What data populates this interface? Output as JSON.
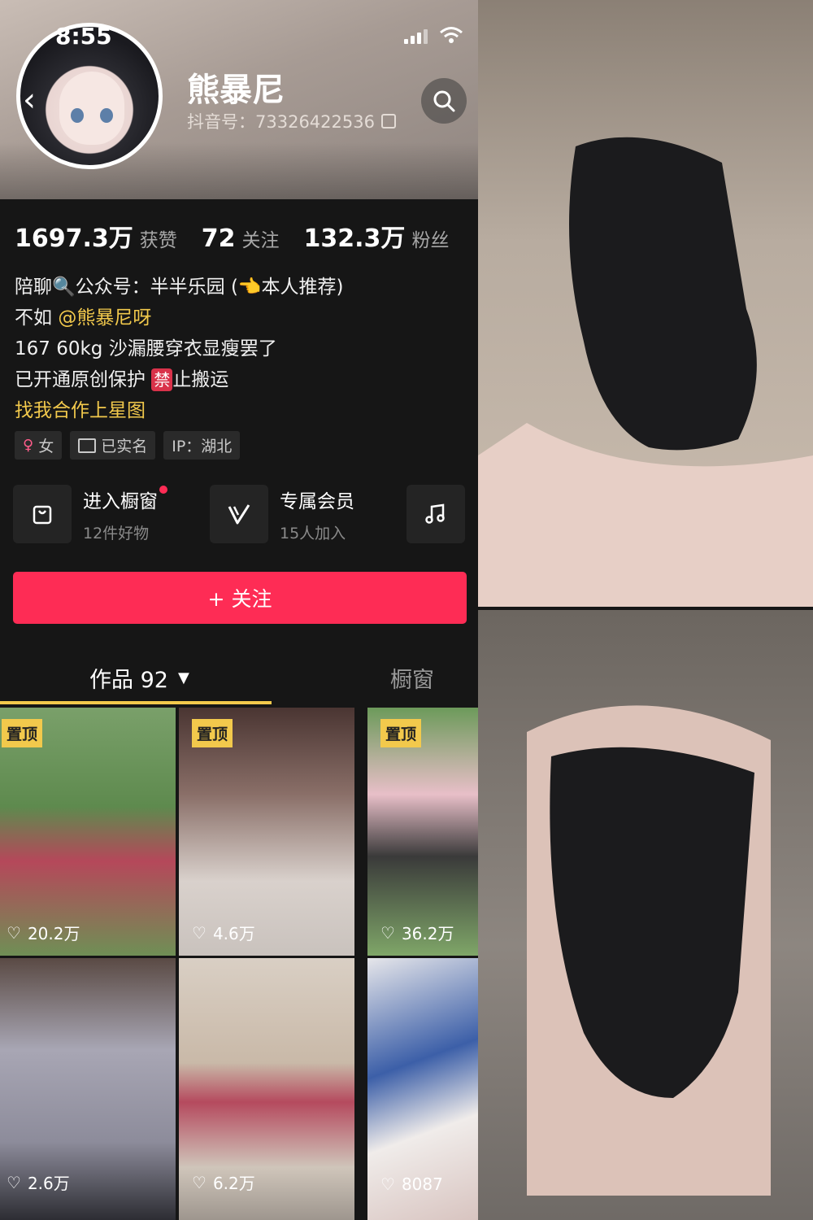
{
  "status_bar": {
    "time": "8:55"
  },
  "profile": {
    "nickname": "熊暴尼",
    "douyin_id": "抖音号：73326422536"
  },
  "stats": [
    {
      "value": "1697.3万",
      "label": "获赞"
    },
    {
      "value": "72",
      "label": "关注"
    },
    {
      "value": "132.3万",
      "label": "粉丝"
    }
  ],
  "bio": {
    "line1": "陪聊🔍公众号：半半乐园 (👈本人推荐)",
    "line2_prefix": "不如",
    "line2_mention": "@熊暴尼呀",
    "line3": "167 60kg 沙漏腰穿衣显瘦罢了",
    "line4_prefix": "已开通原创保护",
    "line4_ban": "禁",
    "line4_suffix": "止搬运",
    "line5": "找我合作上星图"
  },
  "tags": [
    {
      "icon": "female-icon",
      "label": "女"
    },
    {
      "icon": "id-card-icon",
      "label": "已实名"
    },
    {
      "icon": "",
      "label": "IP：湖北"
    }
  ],
  "entries": [
    {
      "icon": "shopping-bag-icon",
      "title": "进入橱窗",
      "sub": "12件好物"
    },
    {
      "icon": "vip-icon",
      "title": "专属会员",
      "sub": "15人加入"
    },
    {
      "icon": "music-icon",
      "title": "",
      "sub": ""
    }
  ],
  "follow_button": "+ 关注",
  "tabs": {
    "works_label": "作品 92",
    "shop_label": "橱窗"
  },
  "videos": [
    {
      "pinned": true,
      "pin_label": "置顶",
      "likes": "20.2万"
    },
    {
      "pinned": true,
      "pin_label": "置顶",
      "likes": "4.6万"
    },
    {
      "pinned": true,
      "pin_label": "置顶",
      "likes": "36.2万"
    },
    {
      "pinned": false,
      "pin_label": "",
      "likes": "2.6万"
    },
    {
      "pinned": false,
      "pin_label": "",
      "likes": "6.2万"
    },
    {
      "pinned": false,
      "pin_label": "",
      "likes": "8087"
    }
  ],
  "colors": {
    "accent_follow": "#fe2c55",
    "pin_yellow": "#f2c94c",
    "mention_yellow": "#f2c94c",
    "background": "#161616"
  }
}
